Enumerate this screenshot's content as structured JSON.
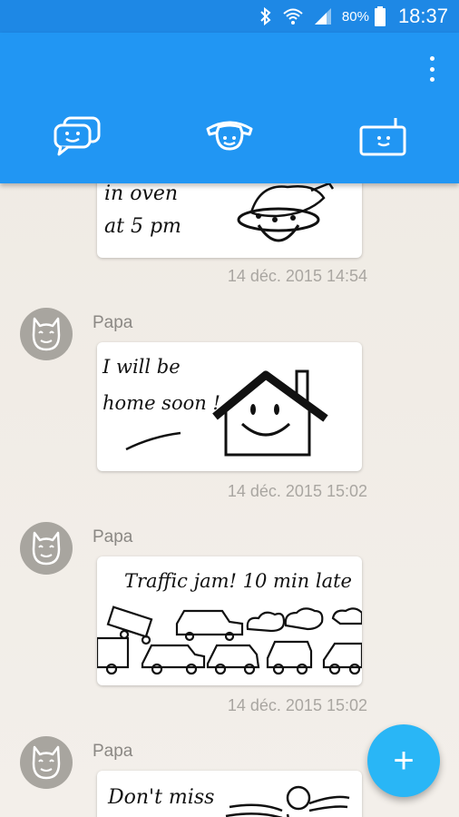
{
  "status_bar": {
    "battery_text": "80%",
    "time": "18:37"
  },
  "tabs": [
    {
      "name": "chat",
      "icon": "chat-bubbles-icon"
    },
    {
      "name": "phone",
      "icon": "phone-icon"
    },
    {
      "name": "device",
      "icon": "device-icon"
    }
  ],
  "messages": [
    {
      "sender": "",
      "text_lines": [
        "in oven",
        "at 5 pm"
      ],
      "timestamp": "14 déc. 2015 14:54"
    },
    {
      "sender": "Papa",
      "text_lines": [
        "I will be",
        "home soon !"
      ],
      "timestamp": "14 déc. 2015 15:02"
    },
    {
      "sender": "Papa",
      "text_lines": [
        "Traffic jam! 10 min late"
      ],
      "timestamp": "14 déc. 2015 15:02"
    },
    {
      "sender": "Papa",
      "text_lines": [
        "Don't miss"
      ],
      "timestamp": ""
    }
  ],
  "fab": {
    "label": "+"
  },
  "colors": {
    "app_bar": "#2196f3",
    "status_bar": "#1e88e5",
    "fab": "#29b6f6"
  }
}
